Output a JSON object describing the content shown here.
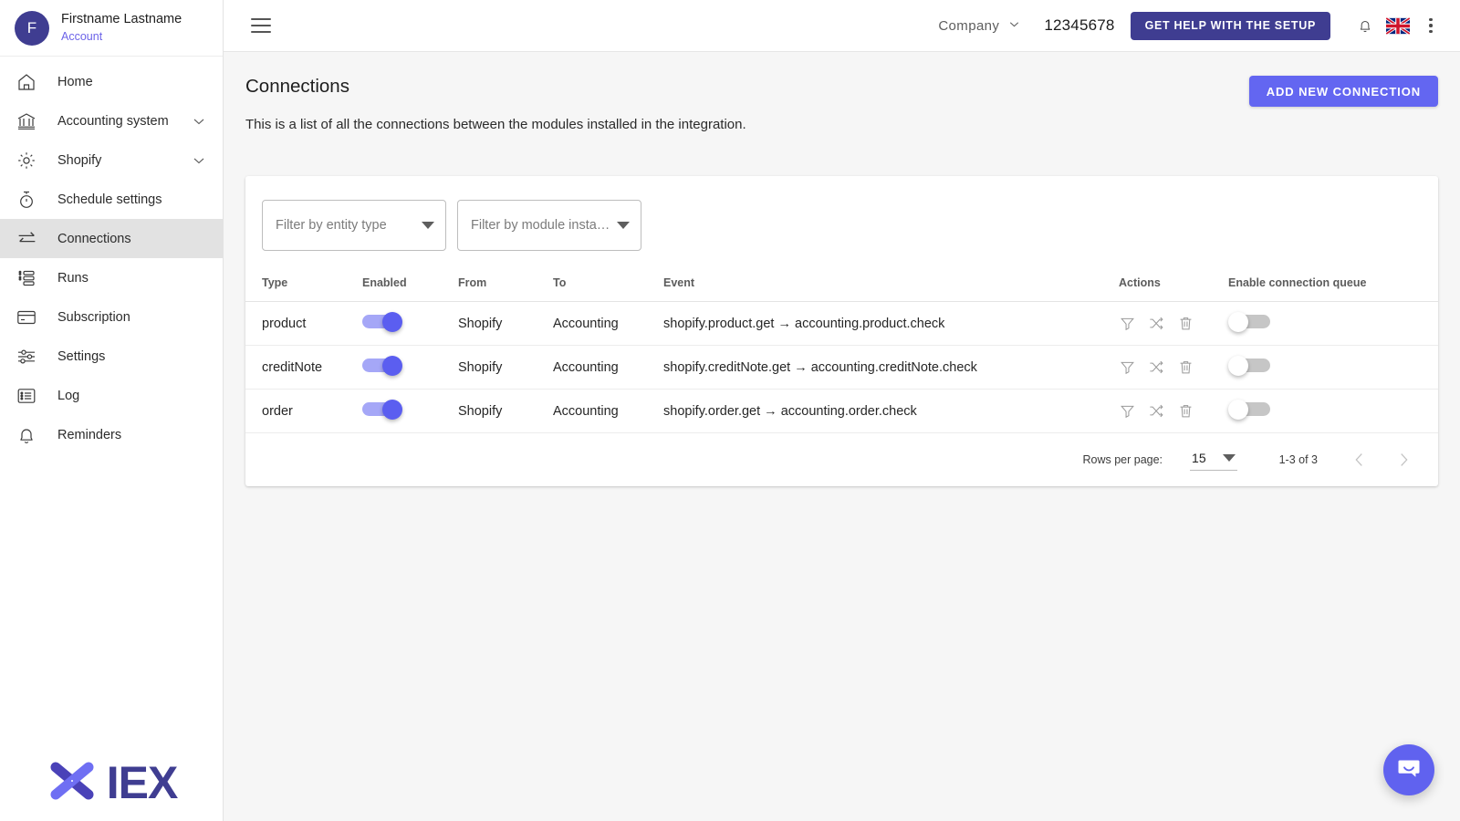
{
  "sidebar": {
    "user": {
      "initial": "F",
      "name": "Firstname Lastname",
      "account_link": "Account"
    },
    "items": [
      {
        "label": "Home",
        "icon": "home-icon",
        "expandable": false,
        "active": false
      },
      {
        "label": "Accounting system",
        "icon": "bank-icon",
        "expandable": true,
        "active": false
      },
      {
        "label": "Shopify",
        "icon": "gear-icon",
        "expandable": true,
        "active": false
      },
      {
        "label": "Schedule settings",
        "icon": "timer-icon",
        "expandable": false,
        "active": false
      },
      {
        "label": "Connections",
        "icon": "exchange-arrows-icon",
        "expandable": false,
        "active": true
      },
      {
        "label": "Runs",
        "icon": "list-runs-icon",
        "expandable": false,
        "active": false
      },
      {
        "label": "Subscription",
        "icon": "credit-card-icon",
        "expandable": false,
        "active": false
      },
      {
        "label": "Settings",
        "icon": "sliders-icon",
        "expandable": false,
        "active": false
      },
      {
        "label": "Log",
        "icon": "log-list-icon",
        "expandable": false,
        "active": false
      },
      {
        "label": "Reminders",
        "icon": "bell-icon",
        "expandable": false,
        "active": false
      }
    ],
    "brand": {
      "text": "IEX",
      "mark": "x-cross-logo-icon"
    }
  },
  "topbar": {
    "menu_icon": "hamburger-menu-icon",
    "company_label": "Company",
    "company_number": "12345678",
    "help_button": "GET HELP WITH THE SETUP",
    "notification_icon": "bell-icon",
    "language_flag": "uk-flag-icon",
    "overflow_icon": "kebab-menu-icon"
  },
  "page": {
    "title": "Connections",
    "subtitle": "This is a list of all the connections between the modules installed in the integration.",
    "add_button": "ADD NEW CONNECTION"
  },
  "filters": [
    {
      "label": "Filter by entity type",
      "name": "filter-entity-type"
    },
    {
      "label": "Filter by module insta…",
      "name": "filter-module-instance"
    }
  ],
  "table": {
    "columns": [
      "Type",
      "Enabled",
      "From",
      "To",
      "Event",
      "Actions",
      "Enable connection queue"
    ],
    "rows": [
      {
        "type": "product",
        "enabled": true,
        "from": "Shopify",
        "to": "Accounting",
        "event": "shopify.product.get → accounting.product.check",
        "queue_enabled": false
      },
      {
        "type": "creditNote",
        "enabled": true,
        "from": "Shopify",
        "to": "Accounting",
        "event": "shopify.creditNote.get → accounting.creditNote.check",
        "queue_enabled": false
      },
      {
        "type": "order",
        "enabled": true,
        "from": "Shopify",
        "to": "Accounting",
        "event": "shopify.order.get → accounting.order.check",
        "queue_enabled": false
      }
    ],
    "row_action_icons": [
      "filter-icon",
      "shuffle-icon",
      "delete-icon"
    ]
  },
  "pagination": {
    "rows_per_page_label": "Rows per page:",
    "rows_per_page_value": "15",
    "range_label": "1-3 of 3",
    "prev_icon": "chevron-left-icon",
    "next_icon": "chevron-right-icon"
  },
  "chat_widget": {
    "icon": "intercom-chat-icon"
  },
  "colors": {
    "brand_indigo": "#3f3d91",
    "accent_indigo": "#6366f1",
    "toggle_on_thumb": "#5b5ef0",
    "toggle_on_track": "#a5a7f7",
    "account_link": "#6c63e8",
    "page_bg": "#f6f6f6"
  }
}
